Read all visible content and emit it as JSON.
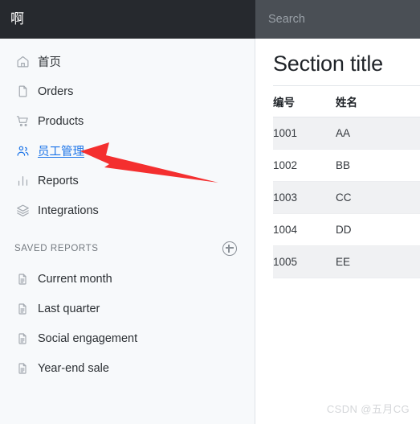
{
  "topbar": {
    "brand_label": "啊",
    "search_placeholder": "Search"
  },
  "sidebar": {
    "nav_items": [
      {
        "label": "首页",
        "icon": "home-icon",
        "active": false
      },
      {
        "label": "Orders",
        "icon": "file-icon",
        "active": false
      },
      {
        "label": "Products",
        "icon": "cart-icon",
        "active": false
      },
      {
        "label": "员工管理",
        "icon": "people-icon",
        "active": true
      },
      {
        "label": "Reports",
        "icon": "bar-chart-icon",
        "active": false
      },
      {
        "label": "Integrations",
        "icon": "layers-icon",
        "active": false
      }
    ],
    "saved_reports": {
      "heading": "SAVED REPORTS",
      "add_icon": "plus-circle-icon",
      "items": [
        {
          "label": "Current month",
          "icon": "document-icon"
        },
        {
          "label": "Last quarter",
          "icon": "document-icon"
        },
        {
          "label": "Social engagement",
          "icon": "document-icon"
        },
        {
          "label": "Year-end sale",
          "icon": "document-icon"
        }
      ]
    }
  },
  "content": {
    "section_title": "Section title",
    "table": {
      "columns": [
        "编号",
        "姓名"
      ],
      "rows": [
        [
          "1001",
          "AA"
        ],
        [
          "1002",
          "BB"
        ],
        [
          "1003",
          "CC"
        ],
        [
          "1004",
          "DD"
        ],
        [
          "1005",
          "EE"
        ]
      ]
    }
  },
  "annotation": {
    "arrow_color": "#f42f2f",
    "arrow_target": "员工管理"
  },
  "watermark": {
    "text": "CSDN @五月CG"
  },
  "colors": {
    "navbar_dark": "#26292e",
    "navbar_light": "#4a4f55",
    "sidebar_bg": "#f7f9fb",
    "accent_blue": "#1a73e8",
    "row_shade": "#f0f1f3"
  }
}
